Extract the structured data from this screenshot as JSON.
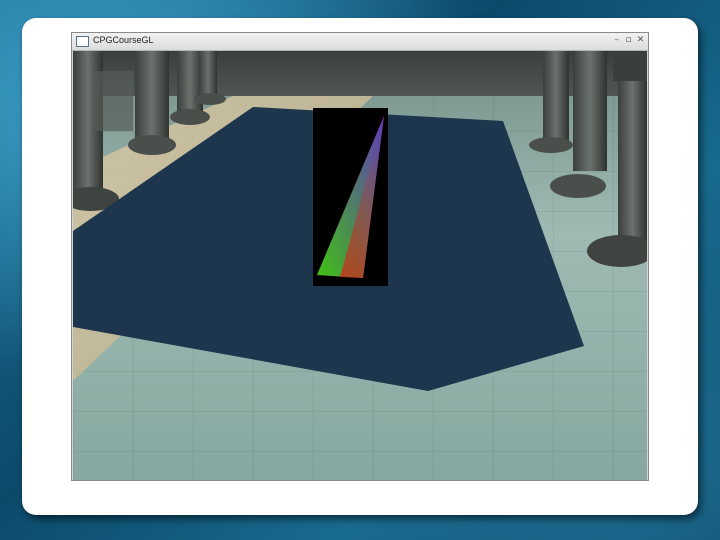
{
  "window": {
    "title": "CPGCourseGL",
    "minimize_glyph": "–",
    "maximize_glyph": "▫",
    "close_glyph": "✕"
  },
  "scene": {
    "background": "stone-temple-floor",
    "water_color": "#1e354e",
    "inset_background": "#000000",
    "triangle_colors": {
      "top": "#4a3fd8",
      "bottom_left": "#22e010",
      "bottom_right": "#e21a18"
    }
  }
}
